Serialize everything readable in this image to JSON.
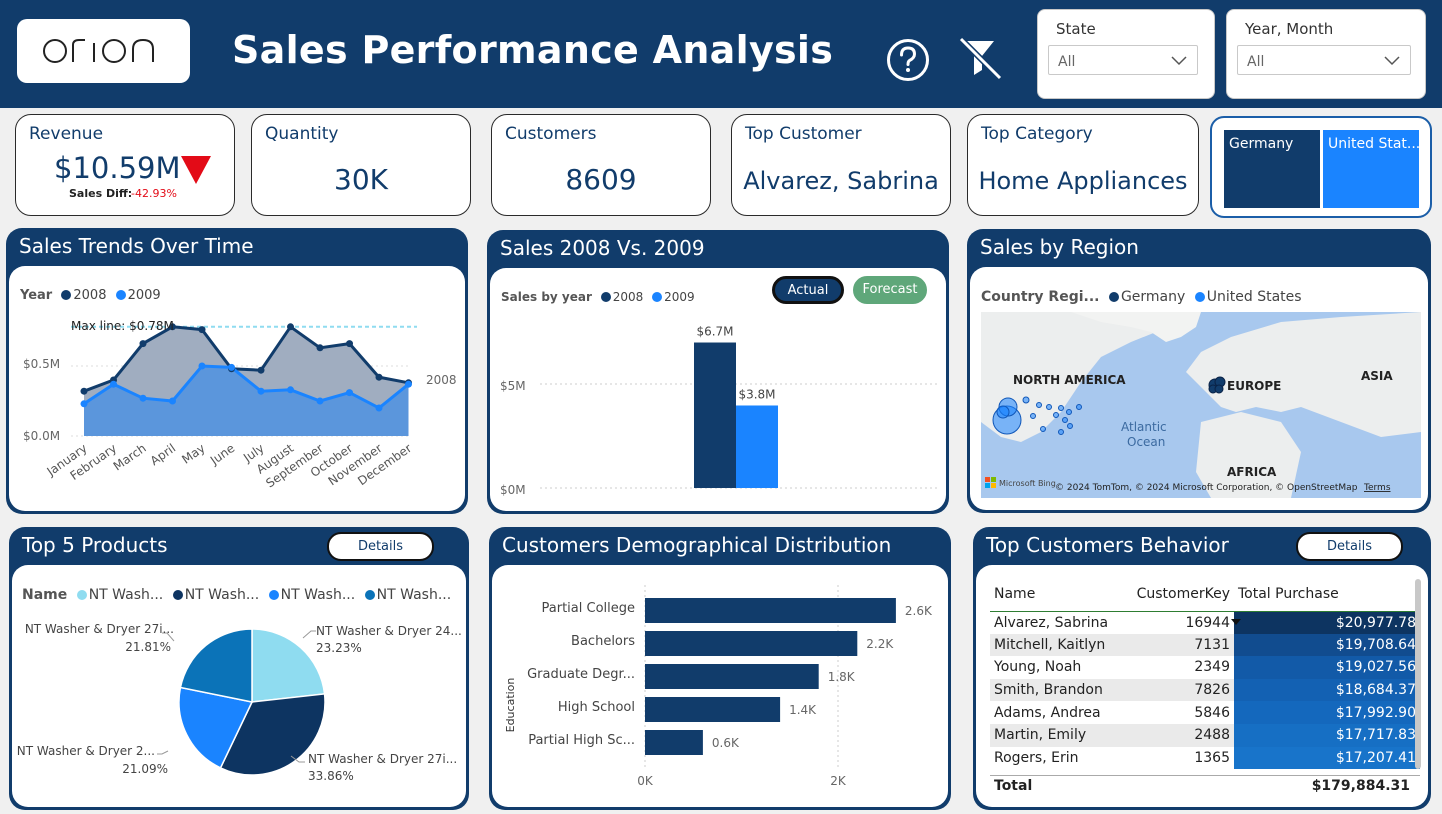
{
  "header": {
    "logo_text": "orion",
    "title": "Sales Performance Analysis",
    "help_icon": "question-circle-icon",
    "filter_icon": "clear-filter-icon"
  },
  "slicers": {
    "state": {
      "label": "State",
      "value": "All"
    },
    "year_month": {
      "label": "Year, Month",
      "value": "All"
    }
  },
  "kpis": {
    "revenue": {
      "label": "Revenue",
      "value": "$10.59M",
      "diff_label": "Sales Diff:",
      "diff_value": "-42.93%",
      "trend_icon": "down-triangle-icon"
    },
    "quantity": {
      "label": "Quantity",
      "value": "30K"
    },
    "customers": {
      "label": "Customers",
      "value": "8609"
    },
    "top_customer": {
      "label": "Top Customer",
      "value": "Alvarez, Sabrina"
    },
    "top_category": {
      "label": "Top Category",
      "value": "Home Appliances"
    }
  },
  "country_buttons": [
    "Germany",
    "United Stat..."
  ],
  "colors": {
    "navy": "#113c6b",
    "blue": "#1a84ff",
    "dark_navy": "#0d3461",
    "forecast": "#5fa77a",
    "alert": "#e30b17"
  },
  "sales_trends": {
    "title": "Sales Trends Over Time",
    "legend_title": "Year",
    "series_labels": [
      "2008",
      "2009"
    ],
    "max_line_label": "Max line: $0.78M",
    "end_label": "2008",
    "y_ticks": [
      "$0.5M",
      "$0.0M"
    ]
  },
  "sales_compare": {
    "title": "Sales 2008 Vs. 2009",
    "legend_title": "Sales by year",
    "series_labels": [
      "2008",
      "2009"
    ],
    "actual_button": "Actual",
    "forecast_button": "Forecast",
    "y_ticks": [
      "$5M",
      "$0M"
    ],
    "bar_labels": [
      "$6.7M",
      "$3.8M"
    ]
  },
  "sales_region": {
    "title": "Sales by Region",
    "legend_title": "Country Regi...",
    "series_labels": [
      "Germany",
      "United States"
    ],
    "map_labels": {
      "na": "NORTH AMERICA",
      "eu": "EUROPE",
      "asia": "ASIA",
      "africa": "AFRICA",
      "ocean1": "Atlantic",
      "ocean2": "Ocean"
    },
    "attribution": "© 2024 TomTom, © 2024 Microsoft Corporation, © OpenStreetMap",
    "terms": "Terms",
    "brand": "Microsoft Bing"
  },
  "top_products": {
    "title": "Top 5 Products",
    "details_button": "Details",
    "legend_title": "Name",
    "legend_items": [
      "NT Wash...",
      "NT Wash...",
      "NT Wash...",
      "NT Wash..."
    ],
    "slice_labels": [
      {
        "name": "NT Washer & Dryer 24...",
        "pct": "23.23%"
      },
      {
        "name": "NT Washer & Dryer 27i...",
        "pct": "33.86%"
      },
      {
        "name": "NT Washer & Dryer 2...",
        "pct": "21.09%"
      },
      {
        "name": "NT Washer & Dryer 27i...",
        "pct": "21.81%"
      }
    ]
  },
  "demographics": {
    "title": "Customers Demographical Distribution",
    "axis_label": "Education",
    "x_ticks": [
      "0K",
      "2K"
    ]
  },
  "top_customers": {
    "title": "Top Customers Behavior",
    "details_button": "Details",
    "columns": [
      "Name",
      "CustomerKey",
      "Total Purchase"
    ],
    "rows": [
      {
        "name": "Alvarez, Sabrina",
        "key": "16944",
        "total": "$20,977.78"
      },
      {
        "name": "Mitchell, Kaitlyn",
        "key": "7131",
        "total": "$19,708.64"
      },
      {
        "name": "Young, Noah",
        "key": "2349",
        "total": "$19,027.56"
      },
      {
        "name": "Smith, Brandon",
        "key": "7826",
        "total": "$18,684.37"
      },
      {
        "name": "Adams, Andrea",
        "key": "5846",
        "total": "$17,992.90"
      },
      {
        "name": "Martin, Emily",
        "key": "2488",
        "total": "$17,717.83"
      },
      {
        "name": "Rogers, Erin",
        "key": "1365",
        "total": "$17,207.41"
      }
    ],
    "total_label": "Total",
    "total_value": "$179,884.31"
  },
  "chart_data": [
    {
      "type": "area",
      "title": "Sales Trends Over Time",
      "x": [
        "January",
        "February",
        "March",
        "April",
        "May",
        "June",
        "July",
        "August",
        "September",
        "October",
        "November",
        "December"
      ],
      "series": [
        {
          "name": "2008",
          "values": [
            0.32,
            0.4,
            0.66,
            0.78,
            0.76,
            0.48,
            0.47,
            0.78,
            0.63,
            0.66,
            0.42,
            0.38
          ]
        },
        {
          "name": "2009",
          "values": [
            0.23,
            0.37,
            0.27,
            0.25,
            0.5,
            0.49,
            0.32,
            0.33,
            0.25,
            0.31,
            0.2,
            0.37
          ]
        }
      ],
      "ylim": [
        0,
        0.8
      ],
      "max_line": 0.78
    },
    {
      "type": "bar",
      "title": "Sales 2008 Vs. 2009",
      "categories": [
        "2008",
        "2009"
      ],
      "values": [
        6.7,
        3.8
      ],
      "ylim": [
        0,
        7
      ]
    },
    {
      "type": "pie",
      "title": "Top 5 Products",
      "categories": [
        "NT Washer & Dryer 24...",
        "NT Washer & Dryer 27i...",
        "NT Washer & Dryer 2...",
        "NT Washer & Dryer 27i..."
      ],
      "values": [
        23.23,
        33.86,
        21.09,
        21.81
      ],
      "colors": [
        "#8fdcf0",
        "#0d3461",
        "#1a84ff",
        "#0b73b8"
      ]
    },
    {
      "type": "bar",
      "title": "Customers Demographical Distribution",
      "ylabel": "Education",
      "categories": [
        "Partial College",
        "Bachelors",
        "Graduate Degr...",
        "High School",
        "Partial High Sc..."
      ],
      "values": [
        2.6,
        2.2,
        1.8,
        1.4,
        0.6
      ],
      "value_labels": [
        "2.6K",
        "2.2K",
        "1.8K",
        "1.4K",
        "0.6K"
      ],
      "xlim": [
        0,
        2.7
      ]
    }
  ]
}
